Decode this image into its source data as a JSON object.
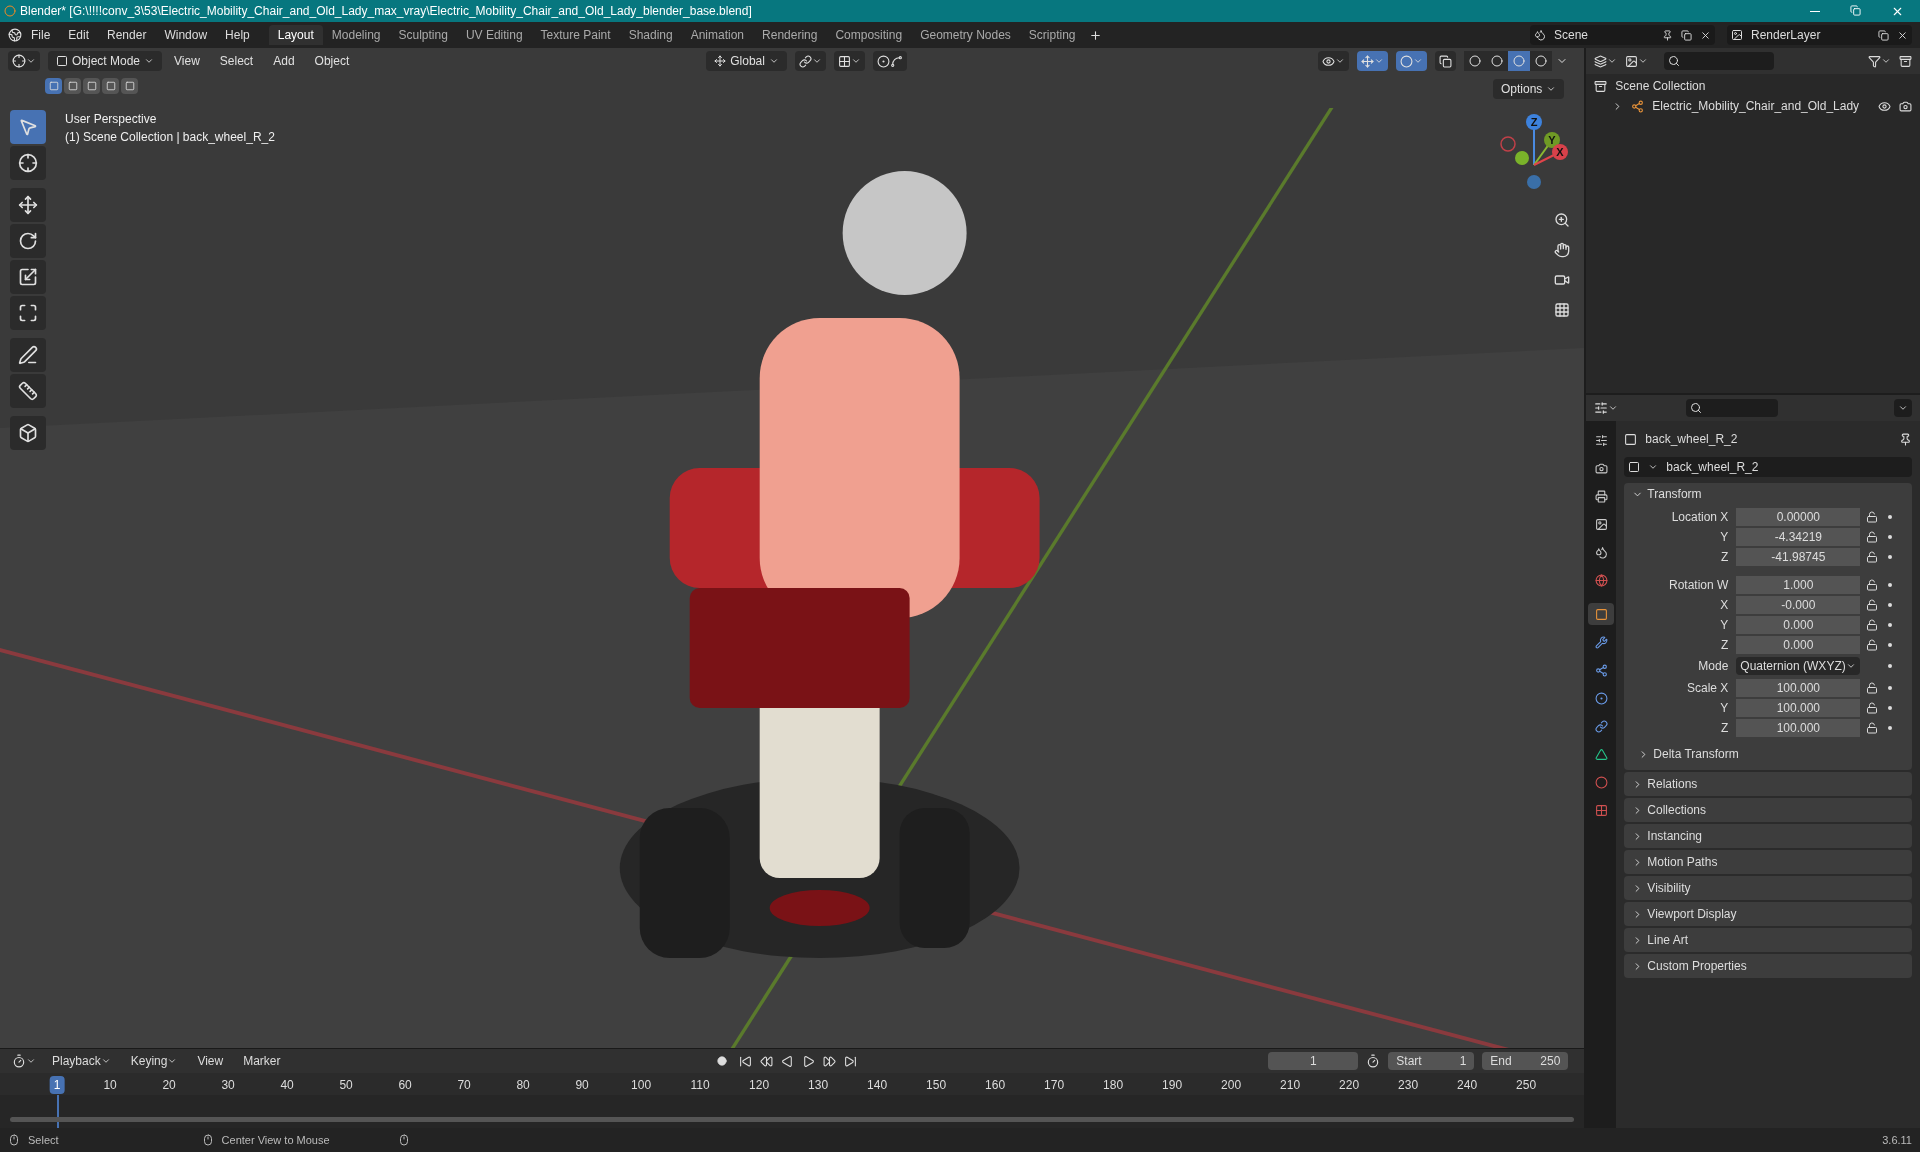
{
  "title_bar": {
    "title": "Blender* [G:\\!!!!conv_3\\53\\Electric_Mobility_Chair_and_Old_Lady_max_vray\\Electric_Mobility_Chair_and_Old_Lady_blender_base.blend]"
  },
  "menu": [
    "File",
    "Edit",
    "Render",
    "Window",
    "Help"
  ],
  "workspaces": [
    {
      "label": "Layout",
      "selected": true
    },
    {
      "label": "Modeling",
      "selected": false
    },
    {
      "label": "Sculpting",
      "selected": false
    },
    {
      "label": "UV Editing",
      "selected": false
    },
    {
      "label": "Texture Paint",
      "selected": false
    },
    {
      "label": "Shading",
      "selected": false
    },
    {
      "label": "Animation",
      "selected": false
    },
    {
      "label": "Rendering",
      "selected": false
    },
    {
      "label": "Compositing",
      "selected": false
    },
    {
      "label": "Geometry Nodes",
      "selected": false
    },
    {
      "label": "Scripting",
      "selected": false
    }
  ],
  "scene": "Scene",
  "render_layer": "RenderLayer",
  "viewport": {
    "mode": "Object Mode",
    "menu": [
      "View",
      "Select",
      "Add",
      "Object"
    ],
    "orientation": "Global",
    "options": "Options",
    "overlay_lines": [
      "User Perspective",
      "(1) Scene Collection | back_wheel_R_2"
    ],
    "tools": [
      {
        "selected": true
      },
      {
        "selected": false
      },
      {
        "selected": false
      },
      {
        "selected": false
      },
      {
        "selected": false
      },
      {
        "selected": false
      },
      {
        "selected": false
      },
      {
        "selected": false
      },
      {
        "selected": false
      }
    ],
    "shading": [
      {
        "selected": false
      },
      {
        "selected": false
      },
      {
        "selected": true
      },
      {
        "selected": false
      }
    ],
    "gizmo": [
      "Z",
      "Y",
      "X"
    ]
  },
  "outliner": {
    "root": "Scene Collection",
    "items": [
      {
        "label": "Electric_Mobility_Chair_and_Old_Lady",
        "expanded": false
      }
    ]
  },
  "properties": {
    "tabs": [
      {
        "selected": false
      },
      {
        "selected": false
      },
      {
        "selected": false
      },
      {
        "selected": false
      },
      {
        "selected": false
      },
      {
        "selected": false
      },
      {
        "selected": true
      },
      {
        "selected": false
      },
      {
        "selected": false
      },
      {
        "selected": false
      },
      {
        "selected": false
      },
      {
        "selected": false
      },
      {
        "selected": false
      },
      {
        "selected": false
      }
    ],
    "object": "back_wheel_R_2",
    "data_name": "back_wheel_R_2",
    "transform": {
      "title": "Transform",
      "expanded": true,
      "location": [
        {
          "label": "Location X",
          "value": "0.00000"
        },
        {
          "label": "Y",
          "value": "-4.34219"
        },
        {
          "label": "Z",
          "value": "-41.98745"
        }
      ],
      "rotation": [
        {
          "label": "Rotation W",
          "value": "1.000"
        },
        {
          "label": "X",
          "value": "-0.000"
        },
        {
          "label": "Y",
          "value": "0.000"
        },
        {
          "label": "Z",
          "value": "0.000"
        }
      ],
      "mode": {
        "label": "Mode",
        "value": "Quaternion (WXYZ)"
      },
      "scale": [
        {
          "label": "Scale X",
          "value": "100.000"
        },
        {
          "label": "Y",
          "value": "100.000"
        },
        {
          "label": "Z",
          "value": "100.000"
        }
      ],
      "subpanel": "Delta Transform"
    },
    "panels": [
      "Relations",
      "Collections",
      "Instancing",
      "Motion Paths",
      "Visibility",
      "Viewport Display",
      "Line Art",
      "Custom Properties"
    ]
  },
  "timeline": {
    "menu": [
      "Playback",
      "Keying",
      "View",
      "Marker"
    ],
    "current_frame": "1",
    "start_label": "Start",
    "start": "1",
    "end_label": "End",
    "end": "250",
    "ticks": [
      "1",
      "10",
      "20",
      "30",
      "40",
      "50",
      "60",
      "70",
      "80",
      "90",
      "100",
      "110",
      "120",
      "130",
      "140",
      "150",
      "160",
      "170",
      "180",
      "190",
      "200",
      "210",
      "220",
      "230",
      "240",
      "250"
    ]
  },
  "status_bar": {
    "items": [
      "Select",
      "Center View to Mouse"
    ],
    "version": "3.6.11"
  }
}
